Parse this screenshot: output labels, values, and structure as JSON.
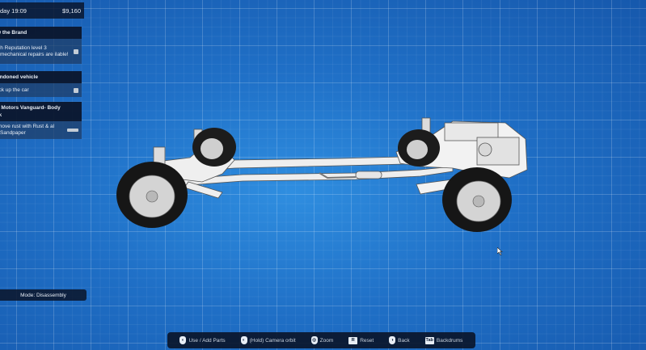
{
  "top_bar": {
    "day_time": "day 19:09",
    "money": "$9,160"
  },
  "job_panel": {
    "header": "w the Brand",
    "task": "ch Reputation level 3 mechanical repairs are ilable!"
  },
  "vehicle_panel": {
    "header": "andoned vehicle",
    "task": "ick up the car"
  },
  "project_panel": {
    "header": "x Motors Vanguard- Body",
    "header_line2": "rk",
    "task": "move rust with Rust & al Sandpaper"
  },
  "mode_button": {
    "label": "Mode: Disassembly"
  },
  "hints": [
    {
      "icon": "mouse-left-icon",
      "key": "",
      "label": "Use / Add Parts"
    },
    {
      "icon": "mouse-left-icon",
      "key": "",
      "label": "(Hold) Camera orbit"
    },
    {
      "icon": "mouse-wheel-icon",
      "key": "",
      "label": "Zoom"
    },
    {
      "icon": "key-icon",
      "key": "R",
      "label": "Reset"
    },
    {
      "icon": "mouse-right-icon",
      "key": "",
      "label": "Back"
    },
    {
      "icon": "key-icon",
      "key": "Tab",
      "label": "Backdrums"
    }
  ],
  "colors": {
    "background": "#1f6fc6",
    "panel_dark": "#0a1428",
    "text": "#e8eef6",
    "chassis": "#f0f0f0",
    "tire": "#1a1a1a"
  }
}
